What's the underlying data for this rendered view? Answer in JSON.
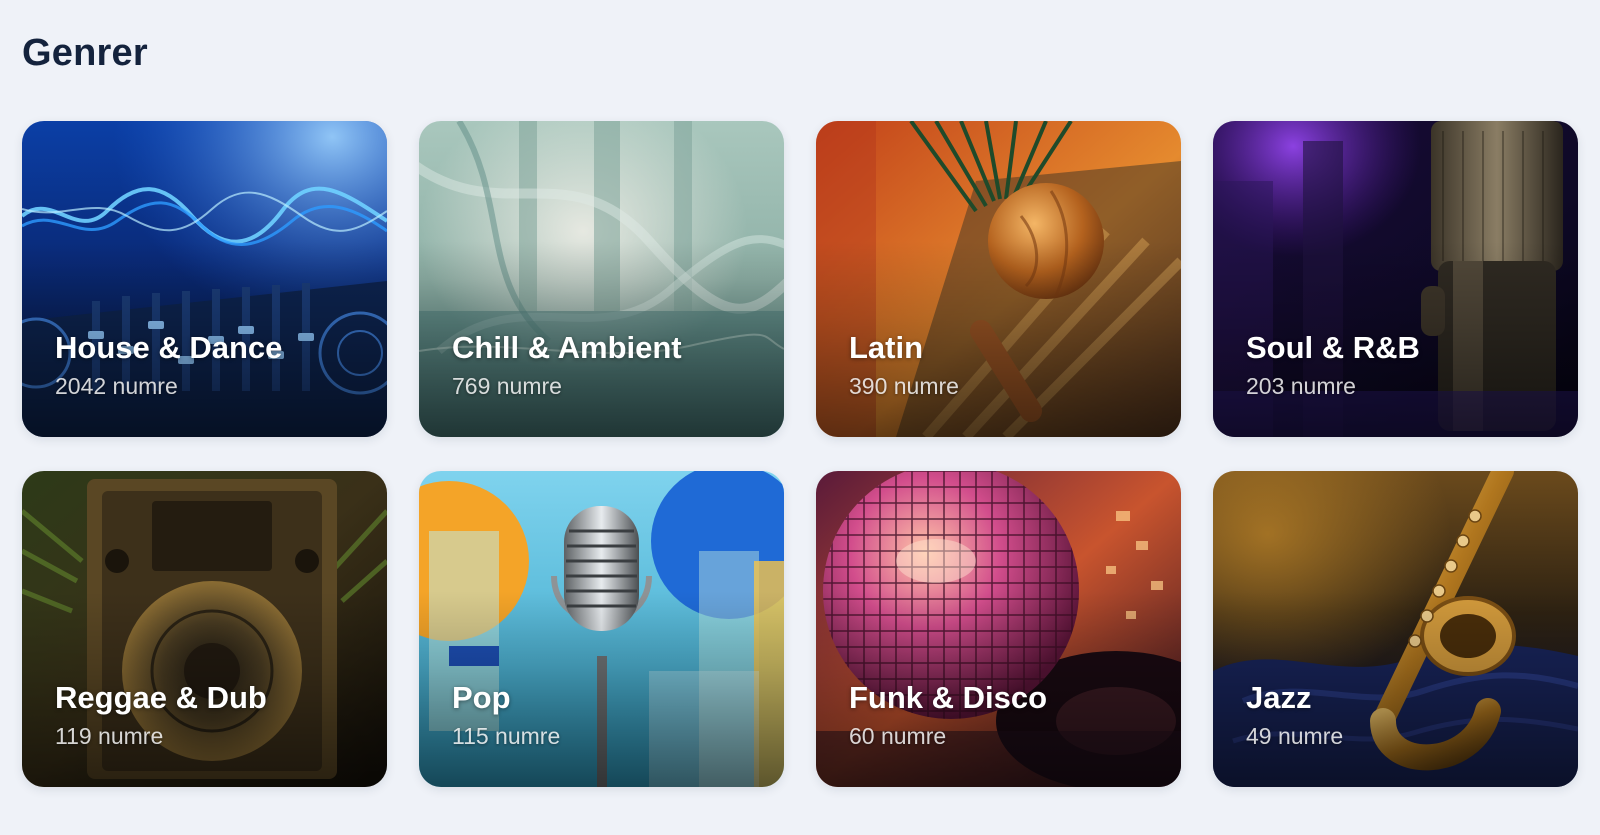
{
  "page": {
    "title": "Genrer"
  },
  "genres": [
    {
      "name": "House & Dance",
      "count": "2042 numre",
      "image": "dj-mixer-soundwave-image",
      "accent": "#1e6fe0"
    },
    {
      "name": "Chill & Ambient",
      "count": "769 numre",
      "image": "translucent-fabric-image",
      "accent": "#7ea59c"
    },
    {
      "name": "Latin",
      "count": "390 numre",
      "image": "maraca-palm-image",
      "accent": "#d8581e"
    },
    {
      "name": "Soul & R&B",
      "count": "203 numre",
      "image": "vintage-microphone-image",
      "accent": "#5a24a8"
    },
    {
      "name": "Reggae & Dub",
      "count": "119 numre",
      "image": "speaker-cabinet-image",
      "accent": "#8a6a2e"
    },
    {
      "name": "Pop",
      "count": "115 numre",
      "image": "pop-microphone-image",
      "accent": "#3cb4d6"
    },
    {
      "name": "Funk & Disco",
      "count": "60 numre",
      "image": "disco-ball-image",
      "accent": "#c43a7a"
    },
    {
      "name": "Jazz",
      "count": "49 numre",
      "image": "saxophone-image",
      "accent": "#c58a2a"
    }
  ]
}
